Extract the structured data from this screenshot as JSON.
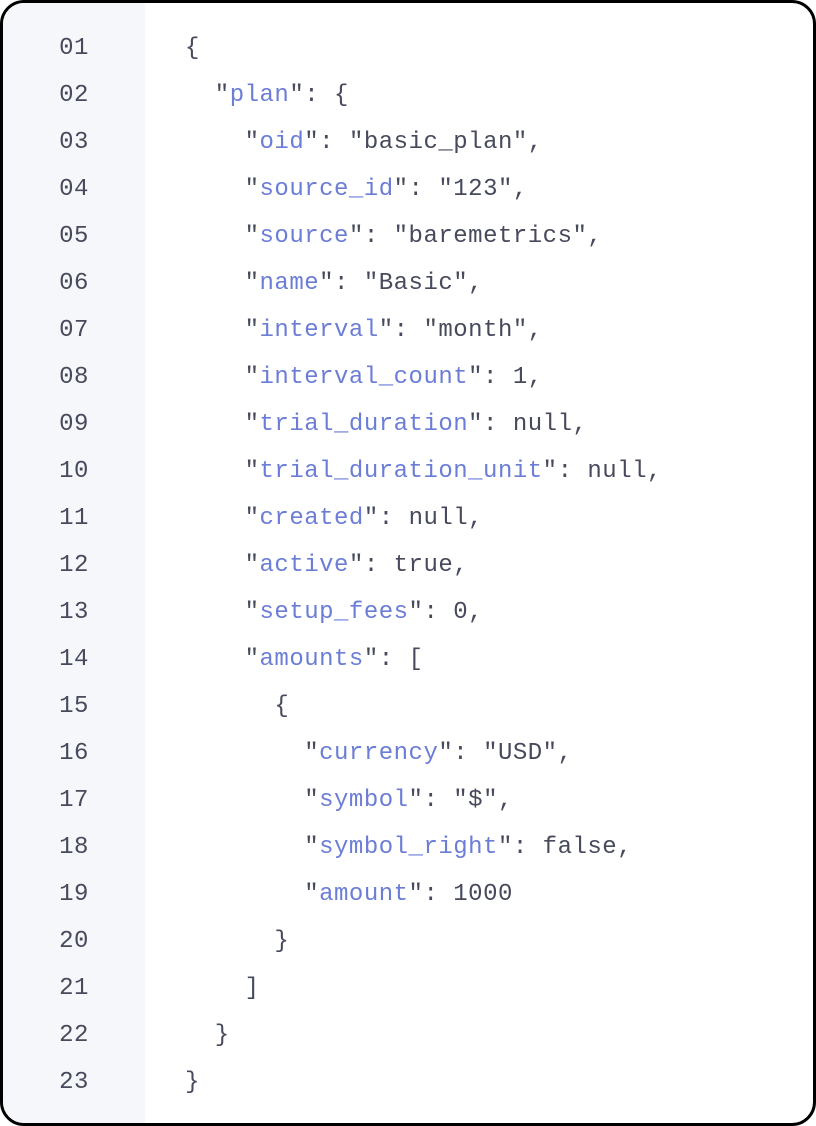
{
  "code": {
    "lines": [
      {
        "num": "01",
        "tokens": [
          {
            "t": "punc",
            "v": "{"
          }
        ]
      },
      {
        "num": "02",
        "tokens": [
          {
            "t": "punc",
            "v": "  \""
          },
          {
            "t": "key",
            "v": "plan"
          },
          {
            "t": "punc",
            "v": "\": {"
          }
        ]
      },
      {
        "num": "03",
        "tokens": [
          {
            "t": "punc",
            "v": "    \""
          },
          {
            "t": "key",
            "v": "oid"
          },
          {
            "t": "punc",
            "v": "\": "
          },
          {
            "t": "str",
            "v": "\"basic_plan\""
          },
          {
            "t": "punc",
            "v": ","
          }
        ]
      },
      {
        "num": "04",
        "tokens": [
          {
            "t": "punc",
            "v": "    \""
          },
          {
            "t": "key",
            "v": "source_id"
          },
          {
            "t": "punc",
            "v": "\": "
          },
          {
            "t": "str",
            "v": "\"123\""
          },
          {
            "t": "punc",
            "v": ","
          }
        ]
      },
      {
        "num": "05",
        "tokens": [
          {
            "t": "punc",
            "v": "    \""
          },
          {
            "t": "key",
            "v": "source"
          },
          {
            "t": "punc",
            "v": "\": "
          },
          {
            "t": "str",
            "v": "\"baremetrics\""
          },
          {
            "t": "punc",
            "v": ","
          }
        ]
      },
      {
        "num": "06",
        "tokens": [
          {
            "t": "punc",
            "v": "    \""
          },
          {
            "t": "key",
            "v": "name"
          },
          {
            "t": "punc",
            "v": "\": "
          },
          {
            "t": "str",
            "v": "\"Basic\""
          },
          {
            "t": "punc",
            "v": ","
          }
        ]
      },
      {
        "num": "07",
        "tokens": [
          {
            "t": "punc",
            "v": "    \""
          },
          {
            "t": "key",
            "v": "interval"
          },
          {
            "t": "punc",
            "v": "\": "
          },
          {
            "t": "str",
            "v": "\"month\""
          },
          {
            "t": "punc",
            "v": ","
          }
        ]
      },
      {
        "num": "08",
        "tokens": [
          {
            "t": "punc",
            "v": "    \""
          },
          {
            "t": "key",
            "v": "interval_count"
          },
          {
            "t": "punc",
            "v": "\": "
          },
          {
            "t": "num",
            "v": "1"
          },
          {
            "t": "punc",
            "v": ","
          }
        ]
      },
      {
        "num": "09",
        "tokens": [
          {
            "t": "punc",
            "v": "    \""
          },
          {
            "t": "key",
            "v": "trial_duration"
          },
          {
            "t": "punc",
            "v": "\": "
          },
          {
            "t": "kw",
            "v": "null"
          },
          {
            "t": "punc",
            "v": ","
          }
        ]
      },
      {
        "num": "10",
        "tokens": [
          {
            "t": "punc",
            "v": "    \""
          },
          {
            "t": "key",
            "v": "trial_duration_unit"
          },
          {
            "t": "punc",
            "v": "\": "
          },
          {
            "t": "kw",
            "v": "null"
          },
          {
            "t": "punc",
            "v": ","
          }
        ]
      },
      {
        "num": "11",
        "tokens": [
          {
            "t": "punc",
            "v": "    \""
          },
          {
            "t": "key",
            "v": "created"
          },
          {
            "t": "punc",
            "v": "\": "
          },
          {
            "t": "kw",
            "v": "null"
          },
          {
            "t": "punc",
            "v": ","
          }
        ]
      },
      {
        "num": "12",
        "tokens": [
          {
            "t": "punc",
            "v": "    \""
          },
          {
            "t": "key",
            "v": "active"
          },
          {
            "t": "punc",
            "v": "\": "
          },
          {
            "t": "kw",
            "v": "true"
          },
          {
            "t": "punc",
            "v": ","
          }
        ]
      },
      {
        "num": "13",
        "tokens": [
          {
            "t": "punc",
            "v": "    \""
          },
          {
            "t": "key",
            "v": "setup_fees"
          },
          {
            "t": "punc",
            "v": "\": "
          },
          {
            "t": "num",
            "v": "0"
          },
          {
            "t": "punc",
            "v": ","
          }
        ]
      },
      {
        "num": "14",
        "tokens": [
          {
            "t": "punc",
            "v": "    \""
          },
          {
            "t": "key",
            "v": "amounts"
          },
          {
            "t": "punc",
            "v": "\": ["
          }
        ]
      },
      {
        "num": "15",
        "tokens": [
          {
            "t": "punc",
            "v": "      {"
          }
        ]
      },
      {
        "num": "16",
        "tokens": [
          {
            "t": "punc",
            "v": "        \""
          },
          {
            "t": "key",
            "v": "currency"
          },
          {
            "t": "punc",
            "v": "\": "
          },
          {
            "t": "str",
            "v": "\"USD\""
          },
          {
            "t": "punc",
            "v": ","
          }
        ]
      },
      {
        "num": "17",
        "tokens": [
          {
            "t": "punc",
            "v": "        \""
          },
          {
            "t": "key",
            "v": "symbol"
          },
          {
            "t": "punc",
            "v": "\": "
          },
          {
            "t": "str",
            "v": "\"$\""
          },
          {
            "t": "punc",
            "v": ","
          }
        ]
      },
      {
        "num": "18",
        "tokens": [
          {
            "t": "punc",
            "v": "        \""
          },
          {
            "t": "key",
            "v": "symbol_right"
          },
          {
            "t": "punc",
            "v": "\": "
          },
          {
            "t": "kw",
            "v": "false"
          },
          {
            "t": "punc",
            "v": ","
          }
        ]
      },
      {
        "num": "19",
        "tokens": [
          {
            "t": "punc",
            "v": "        \""
          },
          {
            "t": "key",
            "v": "amount"
          },
          {
            "t": "punc",
            "v": "\": "
          },
          {
            "t": "num",
            "v": "1000"
          }
        ]
      },
      {
        "num": "20",
        "tokens": [
          {
            "t": "punc",
            "v": "      }"
          }
        ]
      },
      {
        "num": "21",
        "tokens": [
          {
            "t": "punc",
            "v": "    ]"
          }
        ]
      },
      {
        "num": "22",
        "tokens": [
          {
            "t": "punc",
            "v": "  }"
          }
        ]
      },
      {
        "num": "23",
        "tokens": [
          {
            "t": "punc",
            "v": "}"
          }
        ]
      }
    ]
  }
}
